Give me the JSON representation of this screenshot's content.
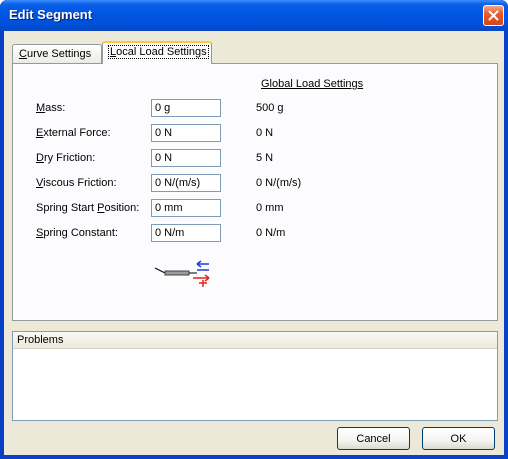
{
  "window": {
    "title": "Edit Segment"
  },
  "tabs": [
    {
      "label": "Curve Settings",
      "accel": "C",
      "rest": "urve Settings",
      "active": false
    },
    {
      "label": "Local Load Settings",
      "accel": "L",
      "rest": "ocal Load Settings",
      "active": true
    }
  ],
  "panel": {
    "global_heading": "Global Load Settings",
    "rows": [
      {
        "label_accel": "M",
        "label_rest": "ass:",
        "label_pre": "",
        "value": "0 g",
        "global": "500 g"
      },
      {
        "label_accel": "E",
        "label_rest": "xternal Force:",
        "label_pre": "",
        "value": "0 N",
        "global": "0 N"
      },
      {
        "label_accel": "D",
        "label_rest": "ry Friction:",
        "label_pre": "",
        "value": "0 N",
        "global": "5 N"
      },
      {
        "label_accel": "V",
        "label_rest": "iscous Friction:",
        "label_pre": "",
        "value": "0 N/(m/s)",
        "global": "0 N/(m/s)"
      },
      {
        "label_pre": "Spring Start ",
        "label_accel": "P",
        "label_rest": "osition:",
        "value": "0 mm",
        "global": "0 mm"
      },
      {
        "label_accel": "S",
        "label_rest": "pring Constant:",
        "label_pre": "",
        "value": "0 N/m",
        "global": "0 N/m"
      }
    ],
    "diagram_icon": "load-direction-icon"
  },
  "problems": {
    "header": "Problems"
  },
  "buttons": {
    "cancel": "Cancel",
    "ok": "OK"
  },
  "colors": {
    "titlebar": "#0054e3",
    "close": "#d4461c",
    "dialog_bg": "#ece9d8",
    "arrow_blue": "#1c3cdc",
    "arrow_red": "#e0241c"
  }
}
